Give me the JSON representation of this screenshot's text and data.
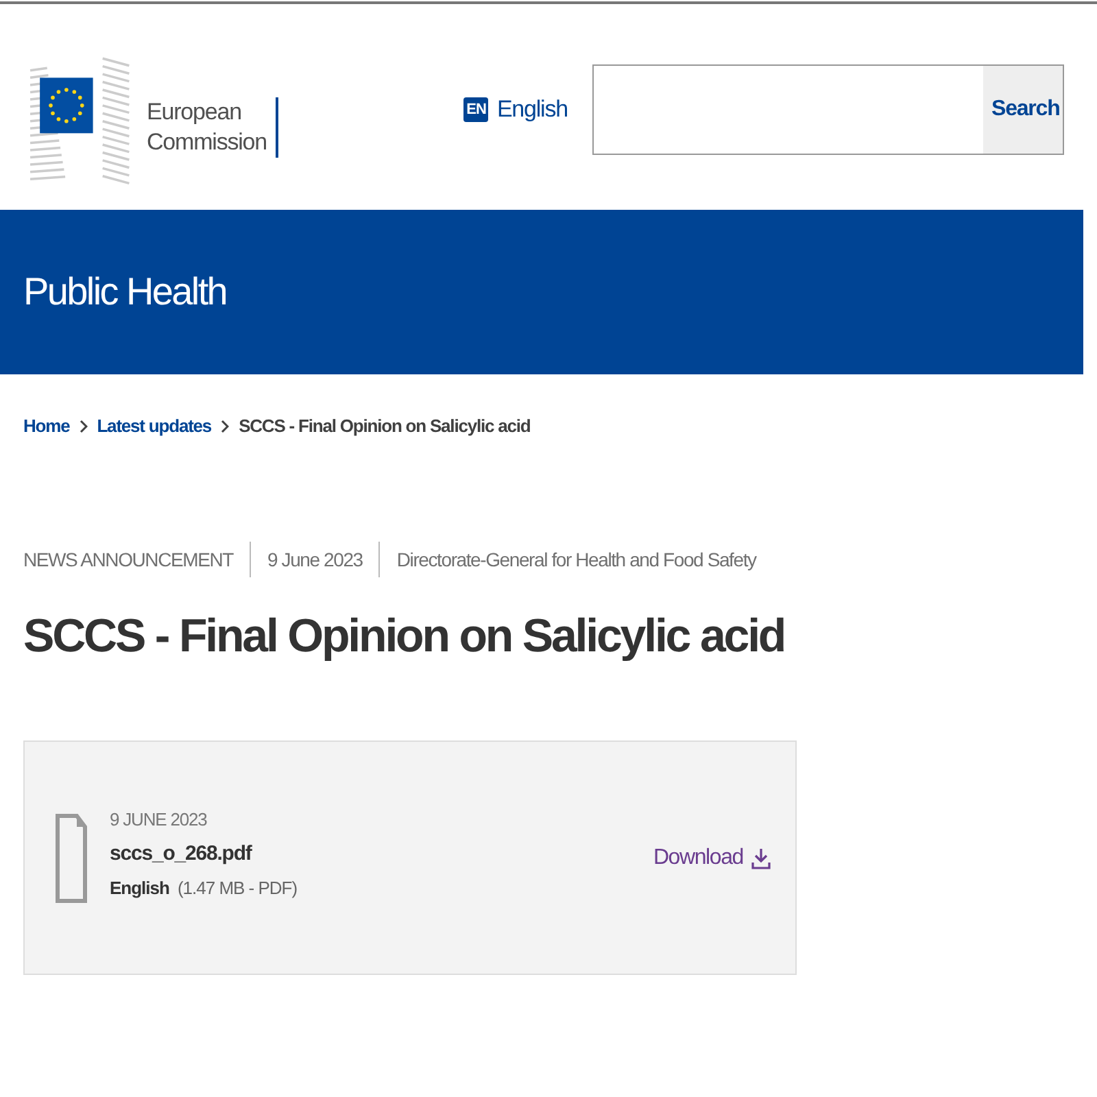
{
  "header": {
    "logo_text": [
      "European",
      "Commission"
    ],
    "language": {
      "code": "EN",
      "label": "English"
    },
    "search": {
      "button": "Search"
    }
  },
  "banner": {
    "title": "Public Health"
  },
  "breadcrumb": [
    {
      "label": "Home",
      "link": true
    },
    {
      "label": "Latest updates",
      "link": true
    },
    {
      "label": "SCCS - Final Opinion on Salicylic acid",
      "link": false
    }
  ],
  "meta": [
    "NEWS ANNOUNCEMENT",
    "9 June 2023",
    "Directorate-General for Health and Food Safety"
  ],
  "title": "SCCS - Final Opinion on Salicylic acid",
  "file": {
    "date": "9 JUNE 2023",
    "name": "sccs_o_268.pdf",
    "language": "English",
    "size": "(1.47 MB - PDF)",
    "action": "Download"
  }
}
